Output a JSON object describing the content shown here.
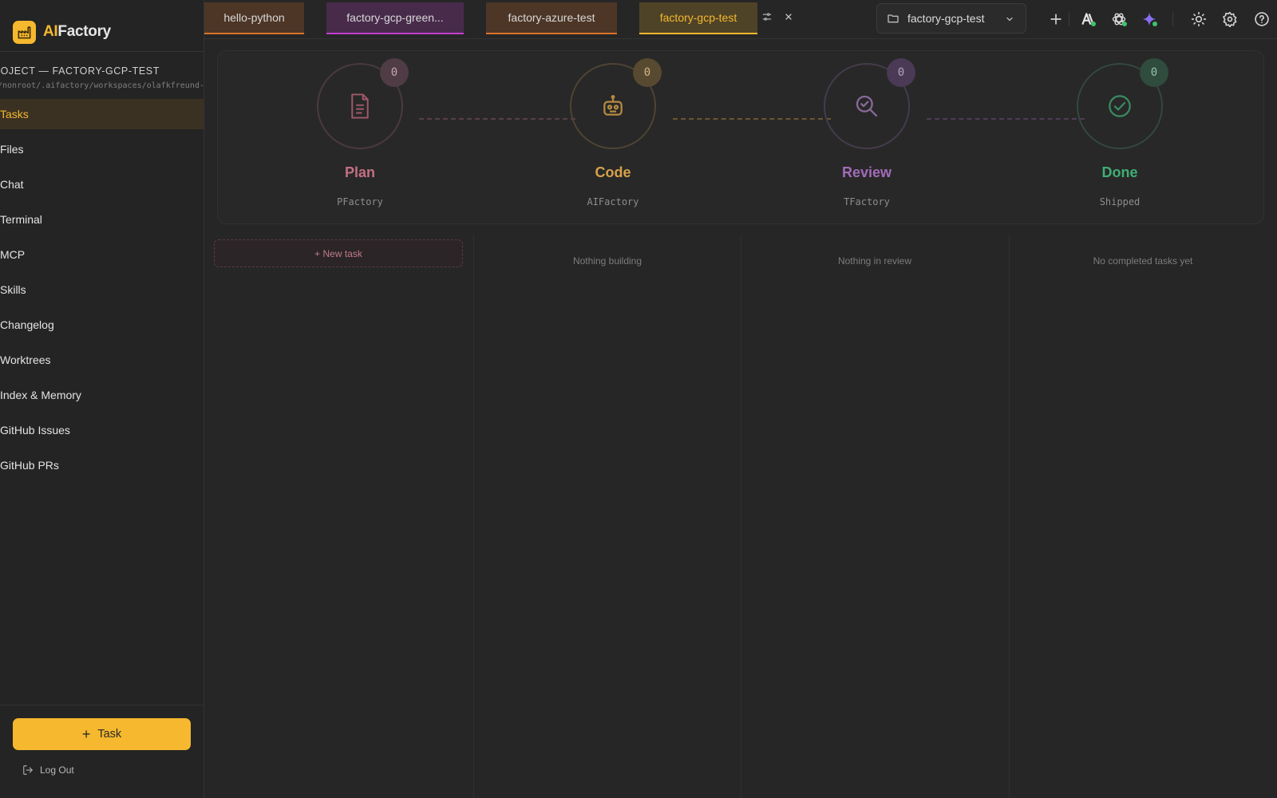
{
  "app": {
    "name_prefix": "AI",
    "name_suffix": "Factory"
  },
  "sidebar": {
    "project_title": "PROJECT — FACTORY-GCP-TEST",
    "project_path": "/nonroot/.aifactory/workspaces/olafkfreund-factory-gcp-test",
    "items": [
      {
        "label": "Tasks",
        "active": true
      },
      {
        "label": "Files"
      },
      {
        "label": "Chat"
      },
      {
        "label": "Terminal"
      },
      {
        "label": "MCP"
      },
      {
        "label": "Skills"
      },
      {
        "label": "Changelog"
      },
      {
        "label": "Worktrees"
      },
      {
        "label": "Index & Memory"
      },
      {
        "label": "GitHub Issues"
      },
      {
        "label": "GitHub PRs"
      }
    ],
    "task_button": "Task",
    "logout": "Log Out"
  },
  "tabs": [
    {
      "label": "hello-python",
      "color": "#d9742b"
    },
    {
      "label": "factory-gcp-green...",
      "color": "#c23fd0"
    },
    {
      "label": "factory-azure-test",
      "color": "#d9742b"
    },
    {
      "label": "factory-gcp-test",
      "color": "#f5b82e",
      "active": true
    }
  ],
  "header": {
    "project_selector": "factory-gcp-test",
    "icons": [
      "add-icon",
      "anthropic-icon",
      "openai-icon",
      "gemini-sparkle-icon",
      "theme-sun-icon",
      "settings-gear-icon",
      "help-icon"
    ]
  },
  "pipeline": {
    "stages": [
      {
        "name": "Plan",
        "subtitle": "PFactory",
        "count": "0",
        "color": "#c26f85",
        "icon": "document-icon"
      },
      {
        "name": "Code",
        "subtitle": "AIFactory",
        "count": "0",
        "color": "#d6a24a",
        "icon": "robot-icon"
      },
      {
        "name": "Review",
        "subtitle": "TFactory",
        "count": "0",
        "color": "#a26bb8",
        "icon": "search-check-icon"
      },
      {
        "name": "Done",
        "subtitle": "Shipped",
        "count": "0",
        "color": "#3fae76",
        "icon": "check-circle-icon"
      }
    ]
  },
  "board": {
    "new_task": "+ New task",
    "empty": [
      "Nothing building",
      "Nothing in review",
      "No completed tasks yet"
    ]
  }
}
